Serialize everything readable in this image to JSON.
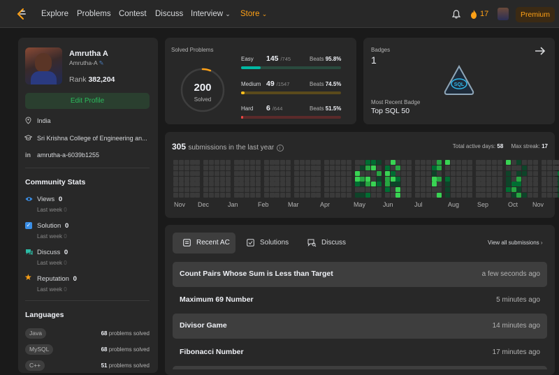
{
  "nav": {
    "items": [
      "Explore",
      "Problems",
      "Contest",
      "Discuss",
      "Interview",
      "Store"
    ],
    "streak": "17",
    "premium": "Premium"
  },
  "profile": {
    "name": "Amrutha A",
    "username": "Amrutha-A",
    "rank_label": "Rank",
    "rank": "382,204",
    "edit": "Edit Profile",
    "location": "India",
    "college": "Sri Krishna College of Engineering an...",
    "linkedin": "amrutha-a-6039b1255"
  },
  "community": {
    "title": "Community Stats",
    "stats": [
      {
        "label": "Views",
        "value": "0",
        "week": "Last week",
        "week_val": "0"
      },
      {
        "label": "Solution",
        "value": "0",
        "week": "Last week",
        "week_val": "0"
      },
      {
        "label": "Discuss",
        "value": "0",
        "week": "Last week",
        "week_val": "0"
      },
      {
        "label": "Reputation",
        "value": "0",
        "week": "Last week",
        "week_val": "0"
      }
    ]
  },
  "languages": {
    "title": "Languages",
    "items": [
      {
        "name": "Java",
        "count": "68",
        "suffix": "problems solved"
      },
      {
        "name": "MySQL",
        "count": "68",
        "suffix": "problems solved"
      },
      {
        "name": "C++",
        "count": "51",
        "suffix": "problems solved"
      }
    ]
  },
  "solved": {
    "title": "Solved Problems",
    "total": "200",
    "total_label": "Solved",
    "ring_fraction": 0.059,
    "levels": [
      {
        "name": "Easy",
        "solved": "145",
        "total": "/745",
        "beats_label": "Beats",
        "beats": "95.8%",
        "fraction": 0.195,
        "color": "#00b8a3",
        "track": "#2a4a3e"
      },
      {
        "name": "Medium",
        "solved": "49",
        "total": "/1547",
        "beats_label": "Beats",
        "beats": "74.5%",
        "fraction": 0.032,
        "color": "#ffc01e",
        "track": "#5a4a1c"
      },
      {
        "name": "Hard",
        "solved": "6",
        "total": "/644",
        "beats_label": "Beats",
        "beats": "51.5%",
        "fraction": 0.009,
        "color": "#ef4743",
        "track": "#5a2a2a"
      }
    ]
  },
  "badges": {
    "title": "Badges",
    "count": "1",
    "recent_label": "Most Recent Badge",
    "recent": "Top SQL 50",
    "badge_text": "SQL"
  },
  "calendar": {
    "count": "305",
    "suffix": "submissions in the last year",
    "active_label": "Total active days:",
    "active": "58",
    "streak_label": "Max streak:",
    "streak": "17",
    "months": [
      "Nov",
      "Dec",
      "Jan",
      "Feb",
      "Mar",
      "Apr",
      "May",
      "Jun",
      "Jul",
      "Aug",
      "Sep",
      "Oct",
      "Nov"
    ]
  },
  "recent": {
    "tabs": [
      "Recent AC",
      "Solutions",
      "Discuss"
    ],
    "view_all": "View all submissions",
    "rows": [
      {
        "title": "Count Pairs Whose Sum is Less than Target",
        "time": "a few seconds ago"
      },
      {
        "title": "Maximum 69 Number",
        "time": "5 minutes ago"
      },
      {
        "title": "Divisor Game",
        "time": "14 minutes ago"
      },
      {
        "title": "Fibonacci Number",
        "time": "17 minutes ago"
      }
    ]
  },
  "colors": {
    "accent": "#ffa116",
    "card": "#282828",
    "bg": "#1a1a1a",
    "green": "#2cbb5d"
  }
}
